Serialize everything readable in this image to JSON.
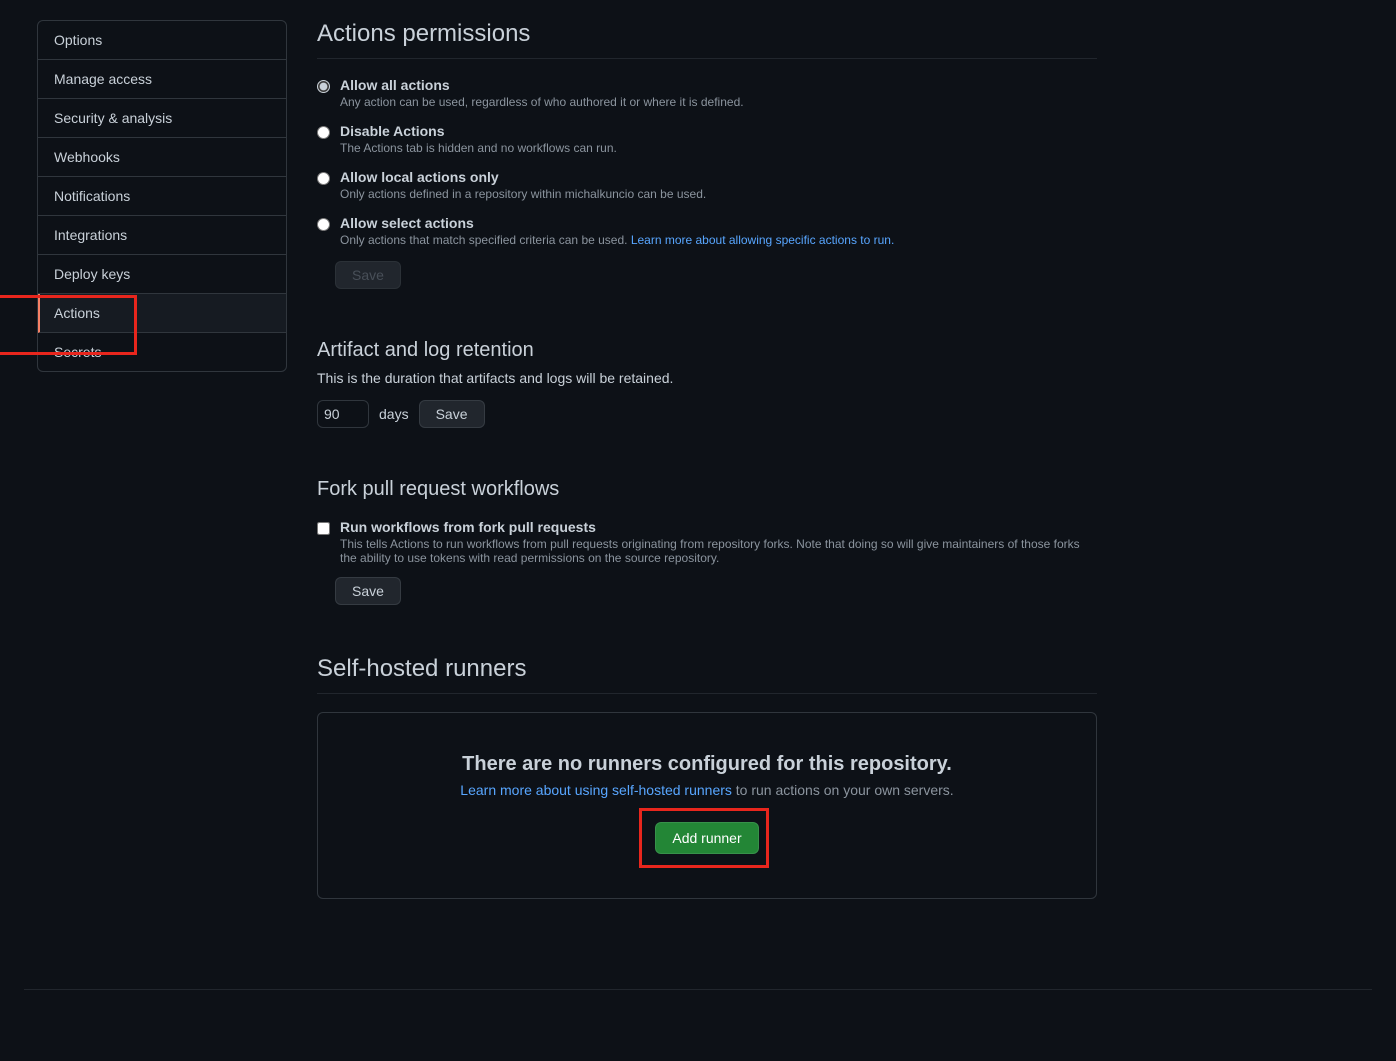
{
  "sidebar": {
    "items": [
      {
        "label": "Options"
      },
      {
        "label": "Manage access"
      },
      {
        "label": "Security & analysis"
      },
      {
        "label": "Webhooks"
      },
      {
        "label": "Notifications"
      },
      {
        "label": "Integrations"
      },
      {
        "label": "Deploy keys"
      },
      {
        "label": "Actions"
      },
      {
        "label": "Secrets"
      }
    ],
    "active_index": 7
  },
  "permissions": {
    "title": "Actions permissions",
    "options": [
      {
        "title": "Allow all actions",
        "desc": "Any action can be used, regardless of who authored it or where it is defined.",
        "selected": true
      },
      {
        "title": "Disable Actions",
        "desc": "The Actions tab is hidden and no workflows can run.",
        "selected": false
      },
      {
        "title": "Allow local actions only",
        "desc": "Only actions defined in a repository within michalkuncio can be used.",
        "selected": false
      },
      {
        "title": "Allow select actions",
        "desc": "Only actions that match specified criteria can be used. ",
        "link": "Learn more about allowing specific actions to run.",
        "selected": false
      }
    ],
    "save_label": "Save"
  },
  "retention": {
    "title": "Artifact and log retention",
    "desc": "This is the duration that artifacts and logs will be retained.",
    "value": "90",
    "days_label": "days",
    "save_label": "Save"
  },
  "fork": {
    "title": "Fork pull request workflows",
    "checkbox_label": "Run workflows from fork pull requests",
    "checkbox_desc": "This tells Actions to run workflows from pull requests originating from repository forks. Note that doing so will give maintainers of those forks the ability to use tokens with read permissions on the source repository.",
    "checked": false,
    "save_label": "Save"
  },
  "runners": {
    "title": "Self-hosted runners",
    "empty_title": "There are no runners configured for this repository.",
    "learn_link": "Learn more about using self-hosted runners",
    "suffix": " to run actions on your own servers.",
    "add_label": "Add runner"
  }
}
